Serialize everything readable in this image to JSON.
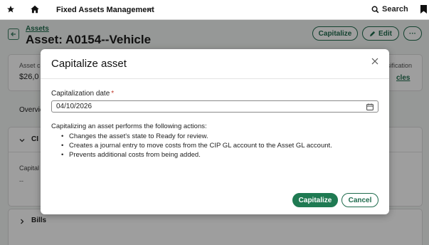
{
  "topbar": {
    "app_name": "Fixed Assets Management",
    "search_label": "Search",
    "icons": [
      "star-icon",
      "home-icon",
      "chevron-down-icon",
      "search-icon",
      "bookmark-icon"
    ]
  },
  "page": {
    "breadcrumb": "Assets",
    "title": "Asset: A0154--Vehicle",
    "buttons": {
      "capitalize": "Capitalize",
      "edit": "Edit",
      "more": "···"
    },
    "summary": {
      "label1": "Asset c",
      "value1": "$26,0",
      "label2": "sification",
      "link2": "cles"
    },
    "tab_overview": "Overvie",
    "cip_section": {
      "title": "CI",
      "field_label": "Capital",
      "field_value": "--"
    },
    "bills_section": {
      "title": "Bills"
    }
  },
  "modal": {
    "title": "Capitalize asset",
    "field_label": "Capitalization date",
    "required_mark": "*",
    "date_value": "04/10/2026",
    "description": "Capitalizing an asset performs the following actions:",
    "bullets": [
      "Changes the asset's state to Ready for review.",
      "Creates a journal entry to move costs from the CIP GL account to the Asset GL account.",
      "Prevents additional costs from being added."
    ],
    "primary_button": "Capitalize",
    "secondary_button": "Cancel"
  },
  "colors": {
    "accent": "#1f7a52",
    "link": "#1f6b4d",
    "required": "#c0392b"
  }
}
